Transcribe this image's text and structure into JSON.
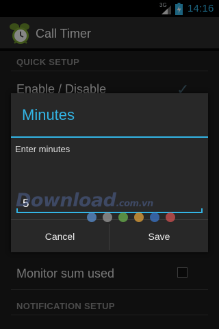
{
  "status_bar": {
    "network": "3G",
    "time": "14:16"
  },
  "action_bar": {
    "title": "Call Timer"
  },
  "sections": {
    "quick_setup": "QUICK SETUP",
    "notification_setup": "NOTIFICATION SETUP"
  },
  "preferences": {
    "enable_disable": {
      "label": "Enable / Disable",
      "checked": true
    },
    "monitor_sum_used": {
      "label": "Monitor sum used",
      "checked": false
    }
  },
  "dialog": {
    "title": "Minutes",
    "message": "Enter minutes",
    "input_value": "5",
    "cancel_label": "Cancel",
    "save_label": "Save"
  },
  "watermark": {
    "text": "Download",
    "suffix": ".com.vn",
    "dot_colors": [
      "#5a8fd0",
      "#9a9a9a",
      "#6ab04c",
      "#e1a23a",
      "#3a74c8",
      "#d05050"
    ]
  },
  "colors": {
    "accent": "#33b5e5",
    "dialog_bg": "#282828",
    "screen_bg": "#1c1c1c"
  }
}
